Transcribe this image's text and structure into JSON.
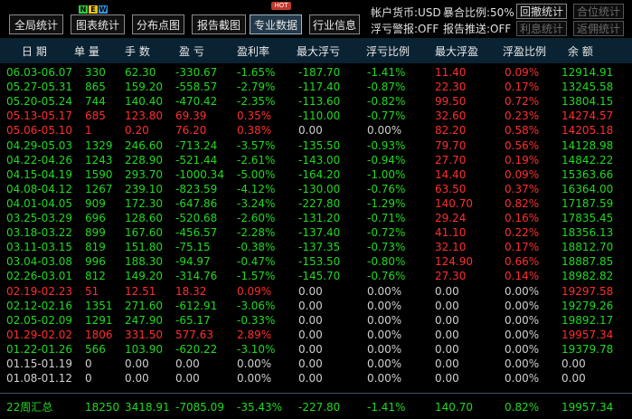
{
  "toolbar": {
    "buttons": [
      {
        "label": "全局统计"
      },
      {
        "label": "图表统计"
      },
      {
        "label": "分布点图"
      },
      {
        "label": "报告截图"
      },
      {
        "label": "专业数据"
      },
      {
        "label": "行业信息"
      }
    ],
    "new_badge": [
      "N",
      "E",
      "W"
    ],
    "hot_badge": "HOT"
  },
  "account": {
    "currency": "帐户货币:USD",
    "exposure": "暴合比例:50%",
    "float_alert": "浮亏警报:OFF",
    "report_push": "报告推送:OFF"
  },
  "right_buttons": [
    "回撤统计",
    "合位统计",
    "利息统计",
    "返佣统计"
  ],
  "columns": [
    "日 期",
    "单 量",
    "手 数",
    "盈 亏",
    "盈利率",
    "最大浮亏",
    "浮亏比例",
    "最大浮盈",
    "浮盈比例",
    "余 额"
  ],
  "rows": [
    {
      "c": [
        "06.03-06.07",
        "330",
        "62.30",
        "-330.67",
        "-1.65%",
        "-187.70",
        "-1.41%",
        "11.40",
        "0.09%",
        "12914.91"
      ],
      "color": [
        "g",
        "g",
        "g",
        "g",
        "g",
        "g",
        "g",
        "r",
        "r",
        "g"
      ]
    },
    {
      "c": [
        "05.27-05.31",
        "865",
        "159.20",
        "-558.57",
        "-2.79%",
        "-117.40",
        "-0.87%",
        "22.30",
        "0.17%",
        "13245.58"
      ],
      "color": [
        "g",
        "g",
        "g",
        "g",
        "g",
        "g",
        "g",
        "r",
        "r",
        "g"
      ]
    },
    {
      "c": [
        "05.20-05.24",
        "744",
        "140.40",
        "-470.42",
        "-2.35%",
        "-113.60",
        "-0.82%",
        "99.50",
        "0.72%",
        "13804.15"
      ],
      "color": [
        "g",
        "g",
        "g",
        "g",
        "g",
        "g",
        "g",
        "r",
        "r",
        "g"
      ]
    },
    {
      "c": [
        "05.13-05.17",
        "685",
        "123.80",
        "69.39",
        "0.35%",
        "-110.00",
        "-0.77%",
        "32.60",
        "0.23%",
        "14274.57"
      ],
      "color": [
        "r",
        "r",
        "r",
        "r",
        "r",
        "g",
        "g",
        "r",
        "r",
        "r"
      ]
    },
    {
      "c": [
        "05.06-05.10",
        "1",
        "0.20",
        "76.20",
        "0.38%",
        "0.00",
        "0.00%",
        "82.20",
        "0.58%",
        "14205.18"
      ],
      "color": [
        "r",
        "r",
        "r",
        "r",
        "r",
        "w",
        "w",
        "r",
        "r",
        "r"
      ]
    },
    {
      "c": [
        "04.29-05.03",
        "1329",
        "246.60",
        "-713.24",
        "-3.57%",
        "-135.50",
        "-0.93%",
        "79.70",
        "0.56%",
        "14128.98"
      ],
      "color": [
        "g",
        "g",
        "g",
        "g",
        "g",
        "g",
        "g",
        "r",
        "r",
        "g"
      ]
    },
    {
      "c": [
        "04.22-04.26",
        "1243",
        "228.90",
        "-521.44",
        "-2.61%",
        "-143.00",
        "-0.94%",
        "27.70",
        "0.19%",
        "14842.22"
      ],
      "color": [
        "g",
        "g",
        "g",
        "g",
        "g",
        "g",
        "g",
        "r",
        "r",
        "g"
      ]
    },
    {
      "c": [
        "04.15-04.19",
        "1590",
        "293.70",
        "-1000.34",
        "-5.00%",
        "-164.20",
        "-1.00%",
        "14.40",
        "0.09%",
        "15363.66"
      ],
      "color": [
        "g",
        "g",
        "g",
        "g",
        "g",
        "g",
        "g",
        "r",
        "r",
        "g"
      ]
    },
    {
      "c": [
        "04.08-04.12",
        "1267",
        "239.10",
        "-823.59",
        "-4.12%",
        "-130.00",
        "-0.76%",
        "63.50",
        "0.37%",
        "16364.00"
      ],
      "color": [
        "g",
        "g",
        "g",
        "g",
        "g",
        "g",
        "g",
        "r",
        "r",
        "g"
      ]
    },
    {
      "c": [
        "04.01-04.05",
        "909",
        "172.30",
        "-647.86",
        "-3.24%",
        "-227.80",
        "-1.29%",
        "140.70",
        "0.82%",
        "17187.59"
      ],
      "color": [
        "g",
        "g",
        "g",
        "g",
        "g",
        "g",
        "g",
        "r",
        "r",
        "g"
      ]
    },
    {
      "c": [
        "03.25-03.29",
        "696",
        "128.60",
        "-520.68",
        "-2.60%",
        "-131.20",
        "-0.71%",
        "29.24",
        "0.16%",
        "17835.45"
      ],
      "color": [
        "g",
        "g",
        "g",
        "g",
        "g",
        "g",
        "g",
        "r",
        "r",
        "g"
      ]
    },
    {
      "c": [
        "03.18-03.22",
        "899",
        "167.60",
        "-456.57",
        "-2.28%",
        "-137.40",
        "-0.72%",
        "41.10",
        "0.22%",
        "18356.13"
      ],
      "color": [
        "g",
        "g",
        "g",
        "g",
        "g",
        "g",
        "g",
        "r",
        "r",
        "g"
      ]
    },
    {
      "c": [
        "03.11-03.15",
        "819",
        "151.80",
        "-75.15",
        "-0.38%",
        "-137.35",
        "-0.73%",
        "32.10",
        "0.17%",
        "18812.70"
      ],
      "color": [
        "g",
        "g",
        "g",
        "g",
        "g",
        "g",
        "g",
        "r",
        "r",
        "g"
      ]
    },
    {
      "c": [
        "03.04-03.08",
        "996",
        "188.30",
        "-94.97",
        "-0.47%",
        "-153.50",
        "-0.80%",
        "124.90",
        "0.66%",
        "18887.85"
      ],
      "color": [
        "g",
        "g",
        "g",
        "g",
        "g",
        "g",
        "g",
        "r",
        "r",
        "g"
      ]
    },
    {
      "c": [
        "02.26-03.01",
        "812",
        "149.20",
        "-314.76",
        "-1.57%",
        "-145.70",
        "-0.76%",
        "27.30",
        "0.14%",
        "18982.82"
      ],
      "color": [
        "g",
        "g",
        "g",
        "g",
        "g",
        "g",
        "g",
        "r",
        "r",
        "g"
      ]
    },
    {
      "c": [
        "02.19-02.23",
        "51",
        "12.51",
        "18.32",
        "0.09%",
        "0.00",
        "0.00%",
        "0.00",
        "0.00%",
        "19297.58"
      ],
      "color": [
        "r",
        "r",
        "r",
        "r",
        "r",
        "w",
        "w",
        "w",
        "w",
        "r"
      ]
    },
    {
      "c": [
        "02.12-02.16",
        "1351",
        "271.60",
        "-612.91",
        "-3.06%",
        "0.00",
        "0.00%",
        "0.00",
        "0.00%",
        "19279.26"
      ],
      "color": [
        "g",
        "g",
        "g",
        "g",
        "g",
        "w",
        "w",
        "w",
        "w",
        "g"
      ]
    },
    {
      "c": [
        "02.05-02.09",
        "1291",
        "247.90",
        "-65.17",
        "-0.33%",
        "0.00",
        "0.00%",
        "0.00",
        "0.00%",
        "19892.17"
      ],
      "color": [
        "g",
        "g",
        "g",
        "g",
        "g",
        "w",
        "w",
        "w",
        "w",
        "g"
      ]
    },
    {
      "c": [
        "01.29-02.02",
        "1806",
        "331.50",
        "577.63",
        "2.89%",
        "0.00",
        "0.00%",
        "0.00",
        "0.00%",
        "19957.34"
      ],
      "color": [
        "r",
        "r",
        "r",
        "r",
        "r",
        "w",
        "w",
        "w",
        "w",
        "r"
      ]
    },
    {
      "c": [
        "01.22-01.26",
        "566",
        "103.90",
        "-620.22",
        "-3.10%",
        "0.00",
        "0.00%",
        "0.00",
        "0.00%",
        "19379.78"
      ],
      "color": [
        "g",
        "g",
        "g",
        "g",
        "g",
        "w",
        "w",
        "w",
        "w",
        "g"
      ]
    },
    {
      "c": [
        "01.15-01.19",
        "0",
        "0.00",
        "0.00",
        "0.00%",
        "0.00",
        "0.00%",
        "0.00",
        "0.00%",
        "0.00"
      ],
      "color": [
        "w",
        "w",
        "w",
        "w",
        "w",
        "w",
        "w",
        "w",
        "w",
        "w"
      ]
    },
    {
      "c": [
        "01.08-01.12",
        "0",
        "0.00",
        "0.00",
        "0.00%",
        "0.00",
        "0.00%",
        "0.00",
        "0.00%",
        "0.00"
      ],
      "color": [
        "w",
        "w",
        "w",
        "w",
        "w",
        "w",
        "w",
        "w",
        "w",
        "w"
      ]
    }
  ],
  "summary": {
    "c": [
      "22周汇总",
      "18250",
      "3418.91",
      "-7085.09",
      "-35.43%",
      "-227.80",
      "-1.41%",
      "140.70",
      "0.82%",
      "19957.34"
    ],
    "color": [
      "g",
      "g",
      "g",
      "g",
      "g",
      "g",
      "g",
      "g",
      "g",
      "g"
    ]
  },
  "colors": {
    "green": "#22d822",
    "red": "#ff2e2e",
    "header_bg": "#0a2333"
  }
}
